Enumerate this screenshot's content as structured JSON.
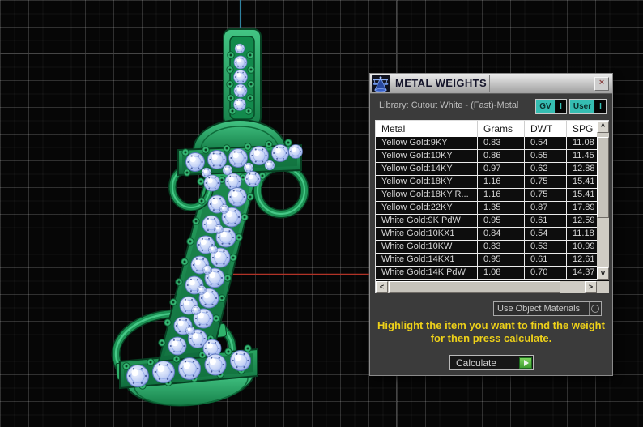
{
  "window": {
    "title": "METAL WEIGHTS"
  },
  "library_label": "Library: Cutout White - (Fast)-Metal",
  "toggles": {
    "gv": {
      "label": "GV",
      "indicator": "I"
    },
    "user": {
      "label": "User",
      "indicator": "I"
    }
  },
  "table": {
    "columns": [
      "Metal",
      "Grams",
      "DWT",
      "SPG"
    ],
    "rows": [
      [
        "Yellow Gold:9KY",
        "0.83",
        "0.54",
        "11.08"
      ],
      [
        "Yellow Gold:10KY",
        "0.86",
        "0.55",
        "11.45"
      ],
      [
        "Yellow Gold:14KY",
        "0.97",
        "0.62",
        "12.88"
      ],
      [
        "Yellow Gold:18KY",
        "1.16",
        "0.75",
        "15.41"
      ],
      [
        "Yellow Gold:18KY R...",
        "1.16",
        "0.75",
        "15.41"
      ],
      [
        "Yellow Gold:22KY",
        "1.35",
        "0.87",
        "17.89"
      ],
      [
        "White Gold:9K PdW",
        "0.95",
        "0.61",
        "12.59"
      ],
      [
        "White Gold:10KX1",
        "0.84",
        "0.54",
        "11.18"
      ],
      [
        "White Gold:10KW",
        "0.83",
        "0.53",
        "10.99"
      ],
      [
        "White Gold:14KX1",
        "0.95",
        "0.61",
        "12.61"
      ],
      [
        "White Gold:14K PdW",
        "1.08",
        "0.70",
        "14.37"
      ]
    ]
  },
  "dropdown": {
    "value": "Use Object Materials"
  },
  "instruction": {
    "line1": "Highlight the item you want to find the weight",
    "line2": "for then press calculate."
  },
  "calculate": {
    "label": "Calculate"
  },
  "icons": {
    "titlebar": "balance-scale-icon",
    "close": "×",
    "scroll_up": "^",
    "scroll_down": "v",
    "scroll_left": "<",
    "scroll_right": ">",
    "calculate_play": "play-triangle",
    "dropdown_indicator": "circle-outline"
  },
  "colors": {
    "panel_body": "#3b3b3b",
    "teal_accent": "#35bdb2",
    "instruction_yellow": "#edd019",
    "header_bg": "#ffffff",
    "row_bg": "#0d0d0d",
    "row_text": "#d6d6d6",
    "metal_green": "#22a05d",
    "gem_blue": "#b6c7f2",
    "axis_red": "#b23327",
    "axis_cyan": "#2f82a0",
    "calculate_green": "#57b847",
    "scrollbar_gray": "#cfccc4"
  }
}
